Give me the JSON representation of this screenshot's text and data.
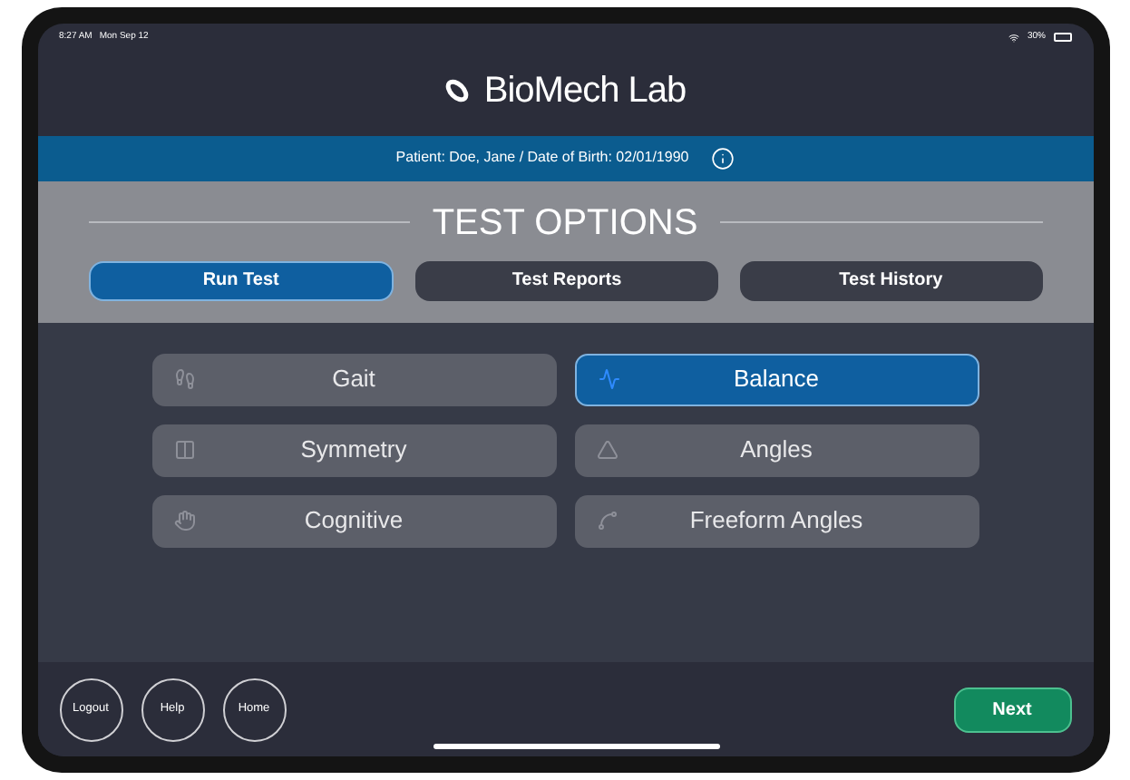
{
  "status_bar": {
    "time": "8:27 AM",
    "date": "Mon Sep 12",
    "battery": "30%"
  },
  "app_title": "BioMech Lab",
  "patient_bar": {
    "text": "Patient: Doe, Jane / Date of Birth: 02/01/1990"
  },
  "section_title": "TEST OPTIONS",
  "tabs": [
    {
      "label": "Run Test",
      "selected": true
    },
    {
      "label": "Test Reports",
      "selected": false
    },
    {
      "label": "Test History",
      "selected": false
    }
  ],
  "tests": [
    {
      "label": "Gait",
      "selected": false
    },
    {
      "label": "Balance",
      "selected": true
    },
    {
      "label": "Symmetry",
      "selected": false
    },
    {
      "label": "Angles",
      "selected": false
    },
    {
      "label": "Cognitive",
      "selected": false
    },
    {
      "label": "Freeform Angles",
      "selected": false
    }
  ],
  "footer_buttons": [
    "Logout",
    "Help",
    "Home"
  ],
  "next_button": "Next"
}
